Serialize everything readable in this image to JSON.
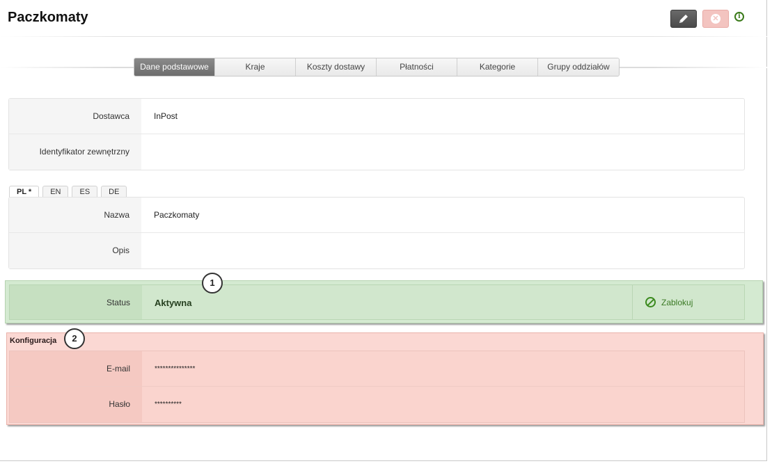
{
  "header": {
    "title": "Paczkomaty",
    "edit_icon": "pencil-icon",
    "delete_icon": "close-circle-icon",
    "info_icon": "info-icon",
    "info_glyph": "i"
  },
  "tabs": [
    {
      "label": "Dane podstawowe",
      "active": true
    },
    {
      "label": "Kraje"
    },
    {
      "label": "Koszty dostawy"
    },
    {
      "label": "Płatności"
    },
    {
      "label": "Kategorie"
    },
    {
      "label": "Grupy oddziałów"
    }
  ],
  "basic": {
    "supplier_label": "Dostawca",
    "supplier_value": "InPost",
    "external_id_label": "Identyfikator zewnętrzny",
    "external_id_value": ""
  },
  "languages": [
    "PL *",
    "EN",
    "ES",
    "DE"
  ],
  "localized": {
    "name_label": "Nazwa",
    "name_value": "Paczkomaty",
    "description_label": "Opis",
    "description_value": ""
  },
  "status": {
    "label": "Status",
    "value": "Aktywna",
    "action_label": "Zablokuj",
    "action_icon": "block-icon"
  },
  "config": {
    "title": "Konfiguracja",
    "email_label": "E-mail",
    "email_value": "***************",
    "password_label": "Hasło",
    "password_value": "**********"
  },
  "callouts": [
    "1",
    "2"
  ],
  "colors": {
    "status_bg": "#d4ead1",
    "config_bg": "#fbd8d3",
    "action_green": "#3b7a25"
  }
}
